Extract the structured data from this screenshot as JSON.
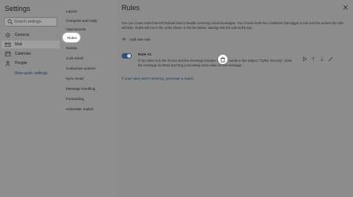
{
  "settings": {
    "title": "Settings",
    "search_placeholder": "Search settings"
  },
  "left_nav": {
    "items": [
      {
        "label": "General"
      },
      {
        "label": "Mail"
      },
      {
        "label": "Calendar"
      },
      {
        "label": "People"
      }
    ],
    "link": "View quick settings"
  },
  "sub_nav": {
    "items": [
      {
        "label": "Layout"
      },
      {
        "label": "Compose and reply"
      },
      {
        "label": "Attachments"
      },
      {
        "label": "Rules"
      },
      {
        "label": "Sweep"
      },
      {
        "label": "Junk email"
      },
      {
        "label": "Customize actions"
      },
      {
        "label": "Sync email"
      },
      {
        "label": "Message handling"
      },
      {
        "label": "Forwarding"
      },
      {
        "label": "Automatic replies"
      }
    ]
  },
  "main": {
    "title": "Rules",
    "description": "You can create rules that tell Outlook how to handle incoming email messages. You choose both the conditions that trigger a rule and the actions the rule will take. Rules will run in the order shown in the list below, starting with the rule at the top.",
    "add_rule": "Add new rule",
    "rule": {
      "name": "Rule #1",
      "description": "If my name is in the To box and the message includes specific words in the subject \"Cyber Security\", mark the message as Read and stop processing more rules on this message",
      "enabled": true
    },
    "report_text": "If your rules aren't working, generate a report."
  },
  "colors": {
    "toggle_on": "#2f4f7a",
    "link": "#1d3a6b",
    "highlight": "#ffffff"
  }
}
